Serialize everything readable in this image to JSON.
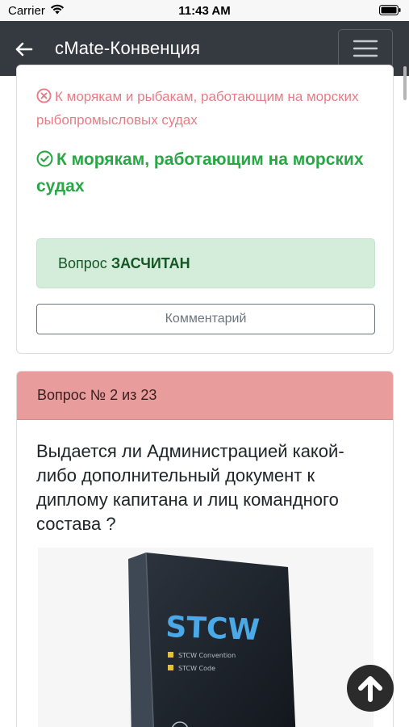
{
  "status_bar": {
    "carrier": "Carrier",
    "time": "11:43 AM"
  },
  "app_bar": {
    "title": "cMate-Конвенция"
  },
  "card1": {
    "wrong_answer": "К морякам и рыбакам, работающим на морских рыбопромысловых судах",
    "correct_answer": "К морякам, работающим на морских судах",
    "result_prefix": "Вопрос",
    "result_status": "ЗАСЧИТАН",
    "comment_button": "Комментарий"
  },
  "card2": {
    "header": "Вопрос № 2 из 23",
    "question": "Выдается ли Администрацией какой-либо дополнительный документ к диплому капитана и лиц командного состава ?",
    "image": {
      "title": "STCW",
      "bullets": [
        "STCW Convention",
        "STCW Code"
      ]
    }
  },
  "colors": {
    "app_bar": "#343a40",
    "wrong": "#dc3545",
    "correct": "#28a745",
    "success_bg": "#d4edda",
    "card_header_bg": "#e89c9c"
  },
  "icons": {
    "back": "arrow-left-icon",
    "menu": "hamburger-icon",
    "wrong": "x-circle-icon",
    "correct": "check-circle-icon",
    "scroll_up": "arrow-up-circle-icon"
  }
}
